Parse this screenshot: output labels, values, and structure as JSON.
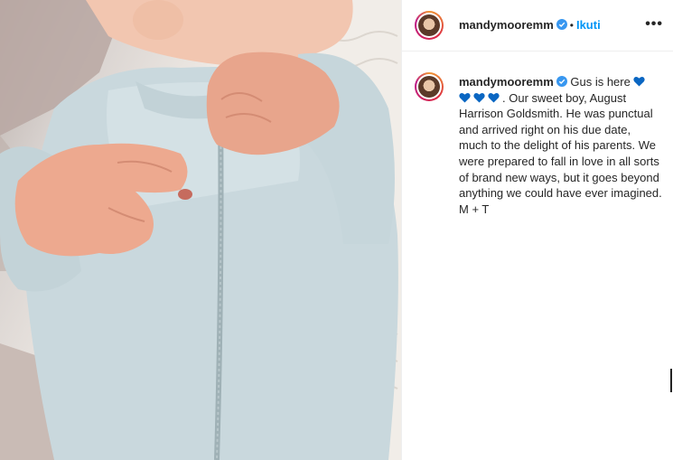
{
  "post": {
    "header": {
      "username": "mandymooremm",
      "dot": "•",
      "follow_label": "Ikuti",
      "more_icon": "more-horizontal-icon"
    },
    "caption": {
      "username": "mandymooremm",
      "text_head": "Gus is here",
      "text_body": ". Our sweet boy, August Harrison Goldsmith. He was punctual and arrived right on his due date, much to the delight of his parents. We were prepared to fall in love in all sorts of brand new ways, but it goes beyond anything we could have ever imagined.",
      "signature": "M + T",
      "heart_icon": "blue-heart-icon",
      "heart_color": "#0a66c2"
    },
    "colors": {
      "verified": "#3897f0",
      "follow": "#0095f6",
      "text": "#262626"
    }
  }
}
